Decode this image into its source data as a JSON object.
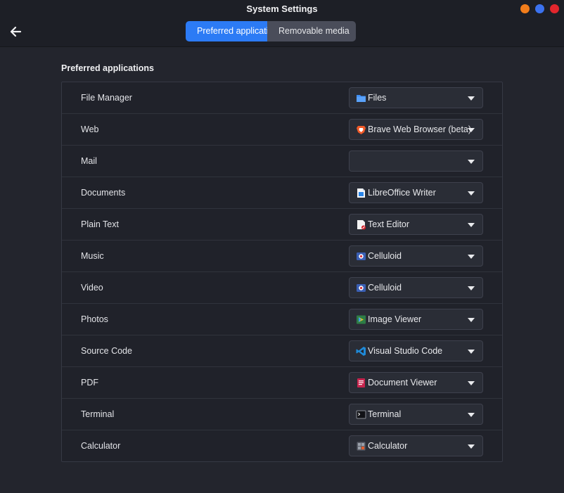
{
  "window": {
    "title": "System Settings"
  },
  "header": {
    "tabs": [
      {
        "label": "Preferred applications",
        "active": true
      },
      {
        "label": "Removable media",
        "active": false
      }
    ]
  },
  "section": {
    "title": "Preferred applications"
  },
  "rows": [
    {
      "label": "File Manager",
      "app": "Files",
      "icon": "folder-icon"
    },
    {
      "label": "Web",
      "app": "Brave Web Browser (beta)",
      "icon": "brave-icon"
    },
    {
      "label": "Mail",
      "app": "",
      "icon": ""
    },
    {
      "label": "Documents",
      "app": "LibreOffice Writer",
      "icon": "libreoffice-writer-icon"
    },
    {
      "label": "Plain Text",
      "app": "Text Editor",
      "icon": "text-editor-icon"
    },
    {
      "label": "Music",
      "app": "Celluloid",
      "icon": "celluloid-icon"
    },
    {
      "label": "Video",
      "app": "Celluloid",
      "icon": "celluloid-icon"
    },
    {
      "label": "Photos",
      "app": "Image Viewer",
      "icon": "image-viewer-icon"
    },
    {
      "label": "Source Code",
      "app": "Visual Studio Code",
      "icon": "vscode-icon"
    },
    {
      "label": "PDF",
      "app": "Document Viewer",
      "icon": "document-viewer-icon"
    },
    {
      "label": "Terminal",
      "app": "Terminal",
      "icon": "terminal-icon"
    },
    {
      "label": "Calculator",
      "app": "Calculator",
      "icon": "calculator-icon"
    }
  ],
  "colors": {
    "accent": "#2c7bf5",
    "minimize": "#f27d1b",
    "maximize": "#3b72f0",
    "close": "#e2262d"
  }
}
